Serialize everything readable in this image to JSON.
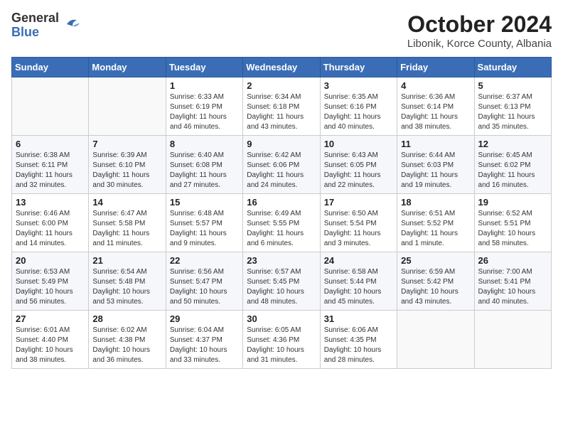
{
  "header": {
    "logo": {
      "general": "General",
      "blue": "Blue"
    },
    "title": "October 2024",
    "subtitle": "Libonik, Korce County, Albania"
  },
  "weekdays": [
    "Sunday",
    "Monday",
    "Tuesday",
    "Wednesday",
    "Thursday",
    "Friday",
    "Saturday"
  ],
  "weeks": [
    [
      {
        "day": "",
        "content": ""
      },
      {
        "day": "",
        "content": ""
      },
      {
        "day": "1",
        "sunrise": "Sunrise: 6:33 AM",
        "sunset": "Sunset: 6:19 PM",
        "daylight": "Daylight: 11 hours and 46 minutes."
      },
      {
        "day": "2",
        "sunrise": "Sunrise: 6:34 AM",
        "sunset": "Sunset: 6:18 PM",
        "daylight": "Daylight: 11 hours and 43 minutes."
      },
      {
        "day": "3",
        "sunrise": "Sunrise: 6:35 AM",
        "sunset": "Sunset: 6:16 PM",
        "daylight": "Daylight: 11 hours and 40 minutes."
      },
      {
        "day": "4",
        "sunrise": "Sunrise: 6:36 AM",
        "sunset": "Sunset: 6:14 PM",
        "daylight": "Daylight: 11 hours and 38 minutes."
      },
      {
        "day": "5",
        "sunrise": "Sunrise: 6:37 AM",
        "sunset": "Sunset: 6:13 PM",
        "daylight": "Daylight: 11 hours and 35 minutes."
      }
    ],
    [
      {
        "day": "6",
        "sunrise": "Sunrise: 6:38 AM",
        "sunset": "Sunset: 6:11 PM",
        "daylight": "Daylight: 11 hours and 32 minutes."
      },
      {
        "day": "7",
        "sunrise": "Sunrise: 6:39 AM",
        "sunset": "Sunset: 6:10 PM",
        "daylight": "Daylight: 11 hours and 30 minutes."
      },
      {
        "day": "8",
        "sunrise": "Sunrise: 6:40 AM",
        "sunset": "Sunset: 6:08 PM",
        "daylight": "Daylight: 11 hours and 27 minutes."
      },
      {
        "day": "9",
        "sunrise": "Sunrise: 6:42 AM",
        "sunset": "Sunset: 6:06 PM",
        "daylight": "Daylight: 11 hours and 24 minutes."
      },
      {
        "day": "10",
        "sunrise": "Sunrise: 6:43 AM",
        "sunset": "Sunset: 6:05 PM",
        "daylight": "Daylight: 11 hours and 22 minutes."
      },
      {
        "day": "11",
        "sunrise": "Sunrise: 6:44 AM",
        "sunset": "Sunset: 6:03 PM",
        "daylight": "Daylight: 11 hours and 19 minutes."
      },
      {
        "day": "12",
        "sunrise": "Sunrise: 6:45 AM",
        "sunset": "Sunset: 6:02 PM",
        "daylight": "Daylight: 11 hours and 16 minutes."
      }
    ],
    [
      {
        "day": "13",
        "sunrise": "Sunrise: 6:46 AM",
        "sunset": "Sunset: 6:00 PM",
        "daylight": "Daylight: 11 hours and 14 minutes."
      },
      {
        "day": "14",
        "sunrise": "Sunrise: 6:47 AM",
        "sunset": "Sunset: 5:58 PM",
        "daylight": "Daylight: 11 hours and 11 minutes."
      },
      {
        "day": "15",
        "sunrise": "Sunrise: 6:48 AM",
        "sunset": "Sunset: 5:57 PM",
        "daylight": "Daylight: 11 hours and 9 minutes."
      },
      {
        "day": "16",
        "sunrise": "Sunrise: 6:49 AM",
        "sunset": "Sunset: 5:55 PM",
        "daylight": "Daylight: 11 hours and 6 minutes."
      },
      {
        "day": "17",
        "sunrise": "Sunrise: 6:50 AM",
        "sunset": "Sunset: 5:54 PM",
        "daylight": "Daylight: 11 hours and 3 minutes."
      },
      {
        "day": "18",
        "sunrise": "Sunrise: 6:51 AM",
        "sunset": "Sunset: 5:52 PM",
        "daylight": "Daylight: 11 hours and 1 minute."
      },
      {
        "day": "19",
        "sunrise": "Sunrise: 6:52 AM",
        "sunset": "Sunset: 5:51 PM",
        "daylight": "Daylight: 10 hours and 58 minutes."
      }
    ],
    [
      {
        "day": "20",
        "sunrise": "Sunrise: 6:53 AM",
        "sunset": "Sunset: 5:49 PM",
        "daylight": "Daylight: 10 hours and 56 minutes."
      },
      {
        "day": "21",
        "sunrise": "Sunrise: 6:54 AM",
        "sunset": "Sunset: 5:48 PM",
        "daylight": "Daylight: 10 hours and 53 minutes."
      },
      {
        "day": "22",
        "sunrise": "Sunrise: 6:56 AM",
        "sunset": "Sunset: 5:47 PM",
        "daylight": "Daylight: 10 hours and 50 minutes."
      },
      {
        "day": "23",
        "sunrise": "Sunrise: 6:57 AM",
        "sunset": "Sunset: 5:45 PM",
        "daylight": "Daylight: 10 hours and 48 minutes."
      },
      {
        "day": "24",
        "sunrise": "Sunrise: 6:58 AM",
        "sunset": "Sunset: 5:44 PM",
        "daylight": "Daylight: 10 hours and 45 minutes."
      },
      {
        "day": "25",
        "sunrise": "Sunrise: 6:59 AM",
        "sunset": "Sunset: 5:42 PM",
        "daylight": "Daylight: 10 hours and 43 minutes."
      },
      {
        "day": "26",
        "sunrise": "Sunrise: 7:00 AM",
        "sunset": "Sunset: 5:41 PM",
        "daylight": "Daylight: 10 hours and 40 minutes."
      }
    ],
    [
      {
        "day": "27",
        "sunrise": "Sunrise: 6:01 AM",
        "sunset": "Sunset: 4:40 PM",
        "daylight": "Daylight: 10 hours and 38 minutes."
      },
      {
        "day": "28",
        "sunrise": "Sunrise: 6:02 AM",
        "sunset": "Sunset: 4:38 PM",
        "daylight": "Daylight: 10 hours and 36 minutes."
      },
      {
        "day": "29",
        "sunrise": "Sunrise: 6:04 AM",
        "sunset": "Sunset: 4:37 PM",
        "daylight": "Daylight: 10 hours and 33 minutes."
      },
      {
        "day": "30",
        "sunrise": "Sunrise: 6:05 AM",
        "sunset": "Sunset: 4:36 PM",
        "daylight": "Daylight: 10 hours and 31 minutes."
      },
      {
        "day": "31",
        "sunrise": "Sunrise: 6:06 AM",
        "sunset": "Sunset: 4:35 PM",
        "daylight": "Daylight: 10 hours and 28 minutes."
      },
      {
        "day": "",
        "content": ""
      },
      {
        "day": "",
        "content": ""
      }
    ]
  ]
}
